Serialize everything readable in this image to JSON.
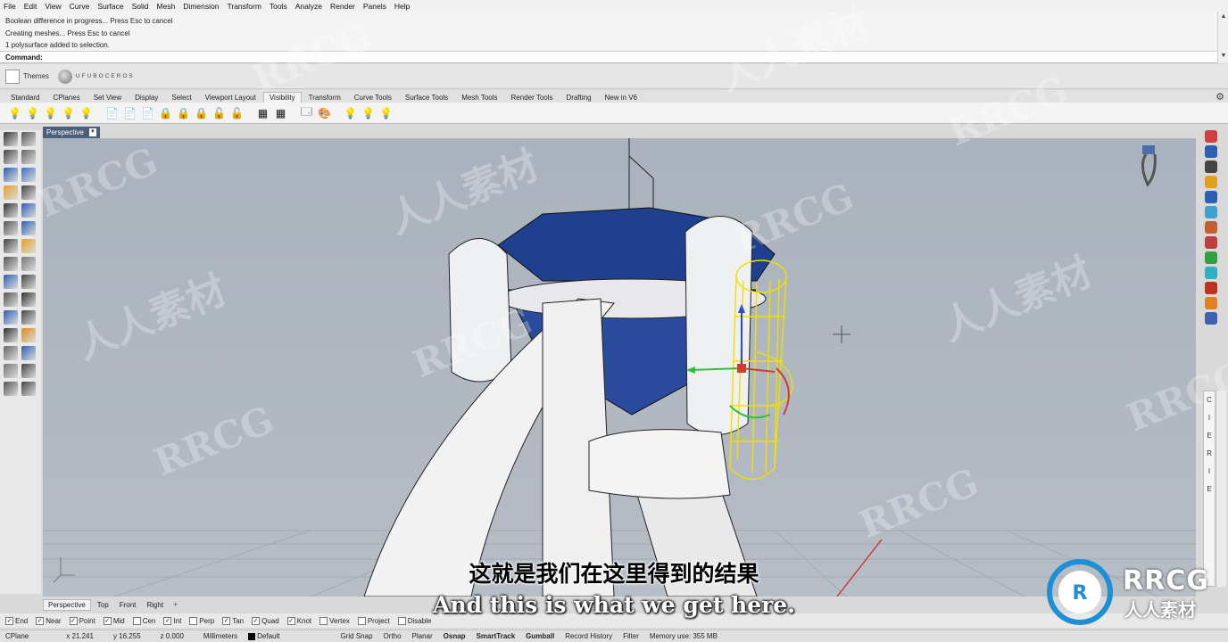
{
  "menu": [
    "File",
    "Edit",
    "View",
    "Curve",
    "Surface",
    "Solid",
    "Mesh",
    "Dimension",
    "Transform",
    "Tools",
    "Analyze",
    "Render",
    "Panels",
    "Help"
  ],
  "history": [
    "Boolean difference in progress... Press Esc to cancel",
    "Creating meshes... Press Esc to cancel",
    "1 polysurface added to selection."
  ],
  "command_label": "Command:",
  "themes": {
    "label": "Themes",
    "brand": "UFUBOCEROS"
  },
  "tabs": [
    "Standard",
    "CPlanes",
    "Set View",
    "Display",
    "Select",
    "Viewport Layout",
    "Visibility",
    "Transform",
    "Curve Tools",
    "Surface Tools",
    "Mesh Tools",
    "Render Tools",
    "Drafting",
    "New in V6"
  ],
  "active_tab": "Visibility",
  "viewport": {
    "name": "Perspective"
  },
  "viewport_tabs": [
    "Perspective",
    "Top",
    "Front",
    "Right"
  ],
  "osnaps": [
    {
      "label": "End",
      "checked": true
    },
    {
      "label": "Near",
      "checked": true
    },
    {
      "label": "Point",
      "checked": true
    },
    {
      "label": "Mid",
      "checked": true
    },
    {
      "label": "Cen",
      "checked": false
    },
    {
      "label": "Int",
      "checked": true
    },
    {
      "label": "Perp",
      "checked": false
    },
    {
      "label": "Tan",
      "checked": true
    },
    {
      "label": "Quad",
      "checked": true
    },
    {
      "label": "Knot",
      "checked": true
    },
    {
      "label": "Vertex",
      "checked": false
    },
    {
      "label": "Project",
      "checked": false
    },
    {
      "label": "Disable",
      "checked": false
    }
  ],
  "status": {
    "cplane": "CPlane",
    "x": "x 21.241",
    "y": "y 16.255",
    "z": "z 0.000",
    "units": "Millimeters",
    "layer": "Default",
    "toggles": [
      "Grid Snap",
      "Ortho",
      "Planar",
      "Osnap",
      "SmartTrack",
      "Gumball",
      "Record History",
      "Filter"
    ],
    "memory": "Memory use: 355 MB"
  },
  "right_strip": [
    "C",
    "I",
    "E",
    "R",
    "I",
    "E"
  ],
  "subtitle": {
    "cn": "这就是我们在这里得到的结果",
    "en": "And this is what we get here."
  },
  "watermark": {
    "latin": "RRCG",
    "cn": "人人素材"
  },
  "colors": {
    "gem": "#1f3f8f",
    "selection": "#f0e000",
    "viewport_bg": "#b0b7c1",
    "tab_active": "#4b5f7b"
  }
}
